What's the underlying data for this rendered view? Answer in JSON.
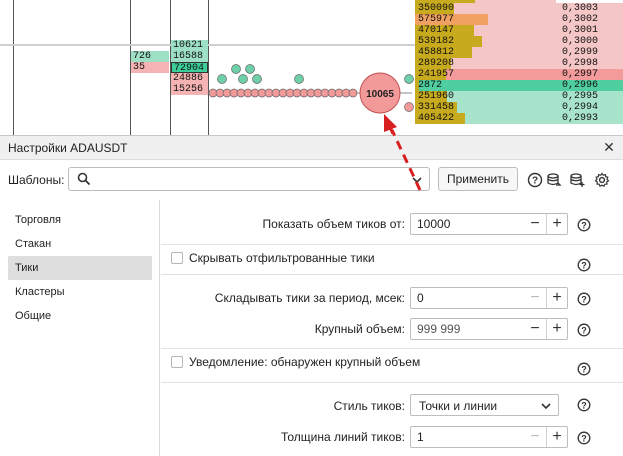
{
  "chart": {
    "left_cells": [
      {
        "text": "10621",
        "color": "#9ee0c6",
        "col": "b",
        "row": 0
      },
      {
        "text": "726",
        "color": "#9ee0c6",
        "col": "a",
        "row": 1
      },
      {
        "text": "16588",
        "color": "#9ee0c6",
        "col": "b",
        "row": 1
      },
      {
        "text": "35",
        "color": "#f5b3b3",
        "col": "a",
        "row": 2
      },
      {
        "text": "72904",
        "color": "#3ccf9a",
        "col": "b",
        "row": 2
      },
      {
        "text": "24886",
        "color": "#f5b3b3",
        "col": "b",
        "row": 3
      },
      {
        "text": "15256",
        "color": "#f5b3b3",
        "col": "b",
        "row": 4
      }
    ],
    "volumes": [
      {
        "text": "350090",
        "fill": 0.28,
        "color": "#c8aa1e"
      },
      {
        "text": "575977",
        "fill": 0.52,
        "color": "#f0a060"
      },
      {
        "text": "470147",
        "fill": 0.42,
        "color": "#c8aa1e"
      },
      {
        "text": "539182",
        "fill": 0.48,
        "color": "#c8aa1e"
      },
      {
        "text": "458812",
        "fill": 0.41,
        "color": "#c8aa1e"
      },
      {
        "text": "289208",
        "fill": 0.26,
        "color": "#c8aa1e"
      },
      {
        "text": "241957",
        "fill": 0.22,
        "color": "#c8aa1e"
      },
      {
        "text": "2872",
        "fill": 0.03,
        "color": "#c8aa1e"
      },
      {
        "text": "251960",
        "fill": 0.23,
        "color": "#c8aa1e"
      },
      {
        "text": "331458",
        "fill": 0.3,
        "color": "#c8aa1e"
      },
      {
        "text": "405422",
        "fill": 0.36,
        "color": "#c8aa1e"
      }
    ],
    "prices": [
      "0,3003",
      "0,3002",
      "0,3001",
      "0,3000",
      "0,2999",
      "0,2998",
      "0,2997",
      "0,2996",
      "0,2995",
      "0,2994",
      "0,2993"
    ],
    "big_tick_label": "10065",
    "colors": {
      "ask": "#f5c6c6",
      "bid": "#a8e4cc",
      "best_ask": "#f39a9a",
      "best_bid": "#4fcf9f",
      "tick_red": "#f29a9a",
      "tick_green": "#6fcfa8",
      "arrow": "#d92020"
    }
  },
  "dialog": {
    "title": "Настройки ADAUSDT",
    "close_icon": "close-icon",
    "templates_label": "Шаблоны:",
    "templates_value": "",
    "apply_label": "Применить",
    "sidebar": [
      {
        "label": "Торговля",
        "active": false
      },
      {
        "label": "Стакан",
        "active": false
      },
      {
        "label": "Тики",
        "active": true
      },
      {
        "label": "Кластеры",
        "active": false
      },
      {
        "label": "Общие",
        "active": false
      }
    ],
    "settings": {
      "show_volume_label": "Показать объем тиков от:",
      "show_volume_value": "10000",
      "hide_filtered_label": "Скрывать отфильтрованные тики",
      "merge_period_label": "Складывать тики за период, мсек:",
      "merge_period_value": "0",
      "large_volume_label": "Крупный объем:",
      "large_volume_value": "999 999",
      "notify_large_label": "Уведомление: обнаружен крупный объем",
      "tick_style_label": "Стиль тиков:",
      "tick_style_value": "Точки и линии",
      "line_width_label": "Толщина линий тиков:",
      "line_width_value": "1"
    }
  }
}
